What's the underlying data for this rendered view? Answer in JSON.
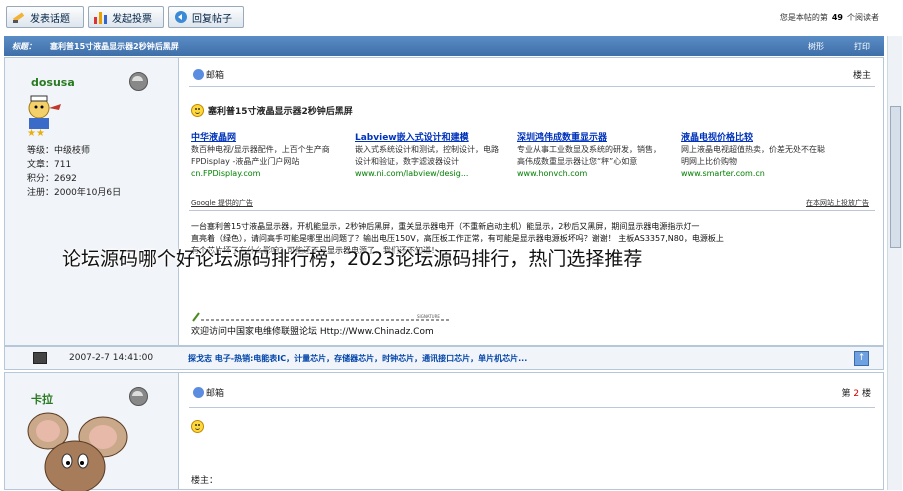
{
  "toolbar": {
    "new_topic": "发表话题",
    "new_poll": "发起投票",
    "reply": "回复帖子",
    "visitors_prefix": "您是本帖的第",
    "visitors_count": "49",
    "visitors_suffix": "个阅读者"
  },
  "topic": {
    "label": "标题：",
    "title": "塞利普15寸液晶显示器2秒钟后黑屏",
    "tree_view": "树形",
    "print": "打印"
  },
  "post1": {
    "author": "dosusa",
    "stars": "★★",
    "level": "等级：中级枝师",
    "posts": "文章：711",
    "points": "积分：2692",
    "registered": "注册：2000年10月6日",
    "mailbox": "邮箱",
    "floor": "楼主",
    "title": "塞利普15寸液晶显示器2秒钟后黑屏",
    "ads": [
      {
        "title": "中华液晶网",
        "desc": "数百种电视/显示器配件，上百个生产商 FPDisplay -液晶产业门户网站",
        "url": "cn.FPDisplay.com"
      },
      {
        "title": "Labview嵌入式设计和建模",
        "desc": "嵌入式系统设计和测试，控制设计，电路设计和验证，数字滤波器设计",
        "url": "www.ni.com/labview/desig..."
      },
      {
        "title": "深圳鸿伟成数重显示器",
        "desc": "专业从事工业数显及系统的研发，销售，高伟成数重显示器让您“秤”心如意",
        "url": "www.honvch.com"
      },
      {
        "title": "液晶电视价格比较",
        "desc": "网上液晶电视超值热卖，价差无处不在聪明网上比价购物",
        "url": "www.smarter.com.cn"
      }
    ],
    "google_ads": "Google 提供的广告",
    "advertise": "在本网站上投放广告",
    "body_line1": "一台塞利普15寸液晶显示器，开机能显示，2秒钟后黑屏，重关显示器电开（不重新启动主机）能显示，2秒后又黑屏，期间显示器电源指示灯一",
    "body_line2": "直亮着（绿色），请问高手可能是哪里出问题了？输出电压150V，高压板工作正常，有可能是显示器电源板坏吗？谢谢！ 主板AS3357,N80，电源板上",
    "body_line3": "有个芯片坏了有什么影响？可能还不是显示器电源了，我们还不知道！",
    "signature_mark": "SIGNATURE",
    "signature": "欢迎访问中国家电维修联盟论坛 Http://Www.Chinadz.Com"
  },
  "watermark": "论坛源码哪个好论坛源码排行榜，2023论坛源码排行，热门选择推荐",
  "footer": {
    "time": "2007-2-7 14:41:00",
    "links": "探戈志 电子-热销:电能表IC，计量芯片，存储器芯片，时钟芯片，通讯接口芯片，单片机芯片..."
  },
  "post2": {
    "author": "卡拉",
    "mailbox": "邮箱",
    "floor_prefix": "第",
    "floor_num": "2",
    "floor_suffix": "楼",
    "body": "楼主："
  },
  "colors": {
    "accent": "#3f6fa9",
    "author_name": "#2a7a22",
    "link": "#0033bb"
  }
}
